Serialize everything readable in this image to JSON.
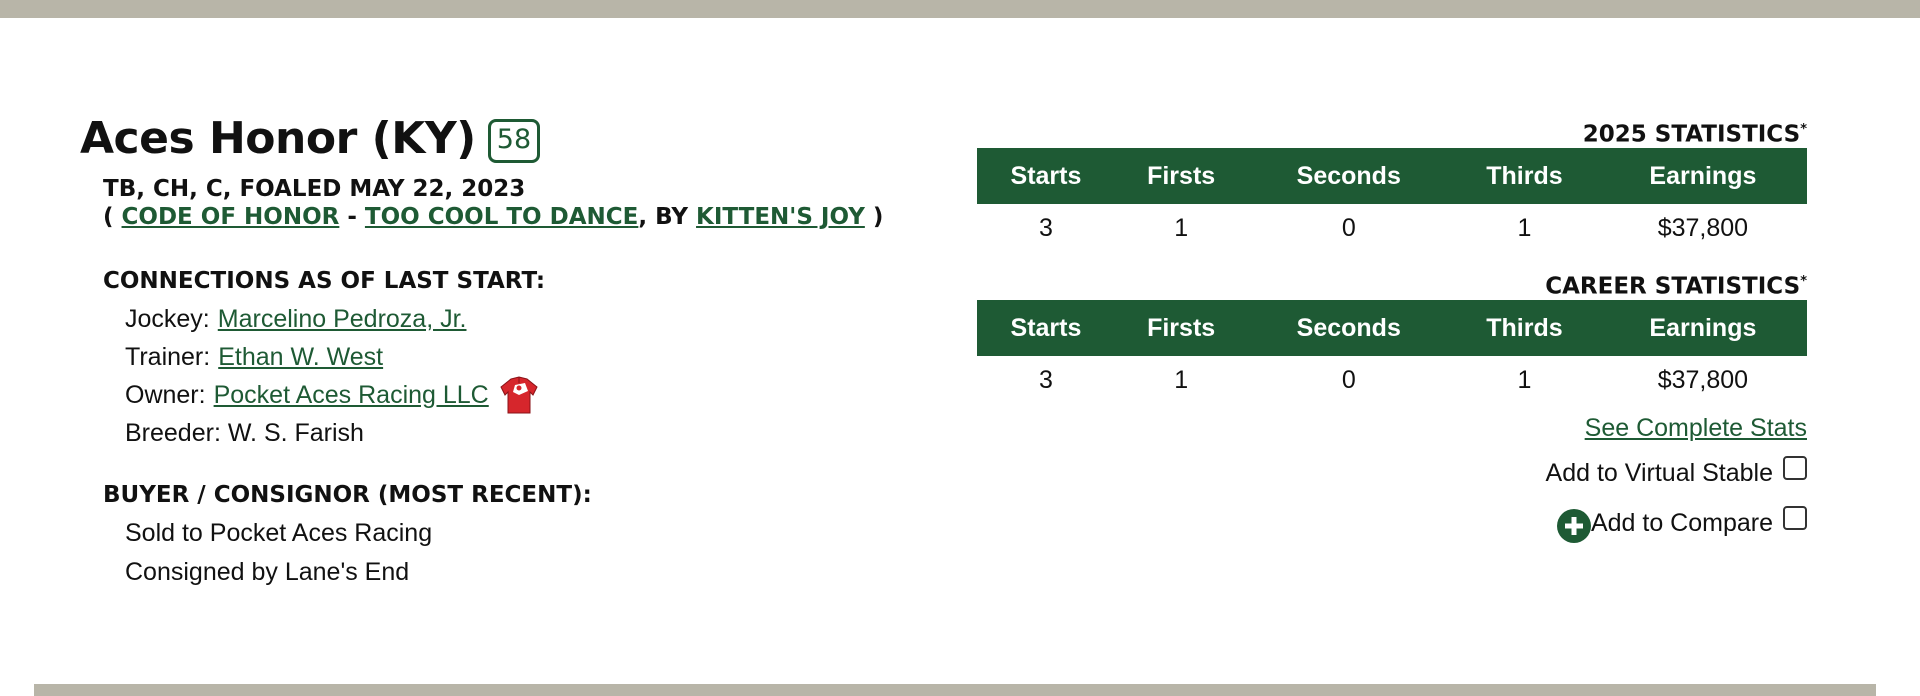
{
  "horse": {
    "name": "Aces Honor (KY)",
    "speed_figure": "58",
    "details": "TB, CH, C, FOALED MAY 22, 2023",
    "sire": "CODE OF HONOR",
    "dam": "TOO COOL TO DANCE",
    "damsire": "KITTEN'S JOY",
    "pedigree_open": "( ",
    "pedigree_dash": " - ",
    "pedigree_by": ", BY ",
    "pedigree_close": " )"
  },
  "connections": {
    "heading": "CONNECTIONS AS OF LAST START:",
    "jockey_label": "Jockey:",
    "jockey": "Marcelino Pedroza, Jr.",
    "trainer_label": "Trainer:",
    "trainer": "Ethan W. West",
    "owner_label": "Owner:",
    "owner": "Pocket Aces Racing LLC",
    "breeder": "Breeder: W. S. Farish"
  },
  "buyer": {
    "heading": "BUYER / CONSIGNOR (MOST RECENT):",
    "sold": "Sold to Pocket Aces Racing",
    "consigned": "Consigned by Lane's End"
  },
  "stats": {
    "columns": [
      "Starts",
      "Firsts",
      "Seconds",
      "Thirds",
      "Earnings"
    ],
    "year_title": "2025 STATISTICS",
    "year_values": [
      "3",
      "1",
      "0",
      "1",
      "$37,800"
    ],
    "career_title": "CAREER STATISTICS",
    "career_values": [
      "3",
      "1",
      "0",
      "1",
      "$37,800"
    ],
    "asterisk": "*",
    "see_complete": "See Complete Stats"
  },
  "actions": {
    "virtual_stable": "Add to Virtual Stable",
    "compare": "Add to Compare"
  },
  "colors": {
    "brand_green": "#1e5a34",
    "bar_gray": "#b8b5a8",
    "silks_red": "#d6262c"
  }
}
